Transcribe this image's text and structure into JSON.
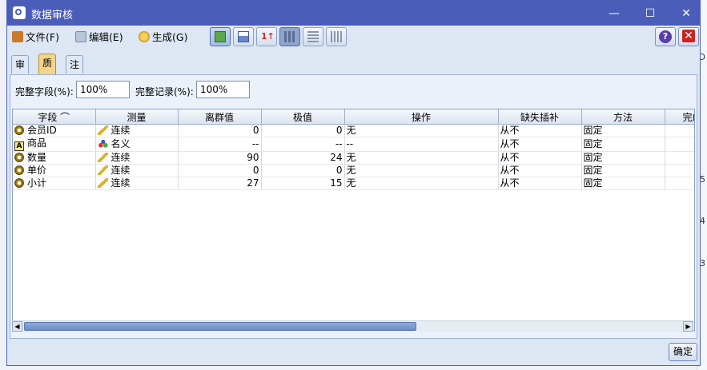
{
  "window": {
    "title": "数据审核"
  },
  "menu": [
    {
      "label": "文件(F)",
      "icon": "file-box-icon",
      "color": "#c97a2a"
    },
    {
      "label": "编辑(E)",
      "icon": "edit-icon",
      "color": "#b7c5d8"
    },
    {
      "label": "生成(G)",
      "icon": "generate-icon",
      "color": "#e0b840"
    }
  ],
  "tabs": [
    {
      "label": "审核",
      "selected": false
    },
    {
      "label": "质量",
      "selected": true
    },
    {
      "label": "注解",
      "selected": false
    }
  ],
  "quality": {
    "complete_fields_label": "完整字段(%):",
    "complete_fields_value": "100%",
    "complete_records_label": "完整记录(%):",
    "complete_records_value": "100%"
  },
  "table": {
    "headers": [
      "字段 ⌒",
      "测量",
      "离群值",
      "极值",
      "操作",
      "缺失插补",
      "方法",
      "完成"
    ],
    "rows": [
      {
        "icon": "continuous-field-icon",
        "field": "会员ID",
        "measure_icon": "ruler-icon",
        "measure": "连续",
        "outliers": "0",
        "extremes": "0",
        "action": "无",
        "impute": "从不",
        "method": "固定"
      },
      {
        "icon": "text-field-icon",
        "field": "商品",
        "measure_icon": "nominal-icon",
        "measure": "名义",
        "outliers": "--",
        "extremes": "--",
        "action": "--",
        "impute": "从不",
        "method": "固定"
      },
      {
        "icon": "continuous-field-icon",
        "field": "数量",
        "measure_icon": "ruler-icon",
        "measure": "连续",
        "outliers": "90",
        "extremes": "24",
        "action": "无",
        "impute": "从不",
        "method": "固定"
      },
      {
        "icon": "continuous-field-icon",
        "field": "单价",
        "measure_icon": "ruler-icon",
        "measure": "连续",
        "outliers": "0",
        "extremes": "0",
        "action": "无",
        "impute": "从不",
        "method": "固定"
      },
      {
        "icon": "continuous-field-icon",
        "field": "小计",
        "measure_icon": "ruler-icon",
        "measure": "连续",
        "outliers": "27",
        "extremes": "15",
        "action": "无",
        "impute": "从不",
        "method": "固定"
      }
    ]
  },
  "buttons": {
    "ok": "确定"
  },
  "background_text": [
    "D",
    "5",
    "4",
    "3"
  ]
}
